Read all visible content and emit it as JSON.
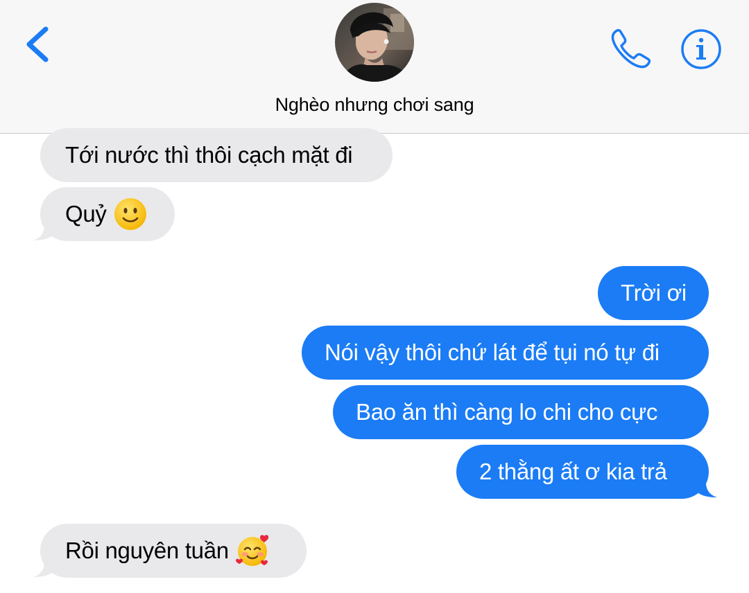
{
  "header": {
    "contact_name": "Nghèo nhưng chơi sang",
    "back_icon": "chevron-left-icon",
    "call_icon": "phone-icon",
    "info_icon": "info-icon"
  },
  "colors": {
    "accent": "#1b7cf5",
    "incoming_bubble": "#e9e9eb",
    "header_bg": "#f7f7f7"
  },
  "messages": [
    {
      "direction": "incoming",
      "text": "Tới nước thì thôi cạch mặt đi"
    },
    {
      "direction": "incoming",
      "text": "Quỷ",
      "emoji": "slightly-smiling-face"
    },
    {
      "direction": "outgoing",
      "text": "Trời ơi"
    },
    {
      "direction": "outgoing",
      "text": "Nói vậy thôi chứ lát để tụi nó tự đi"
    },
    {
      "direction": "outgoing",
      "text": "Bao ăn thì càng lo chi cho cực"
    },
    {
      "direction": "outgoing",
      "text": "2 thằng ất ơ kia trả"
    },
    {
      "direction": "incoming",
      "text": "Rồi nguyên tuần",
      "emoji": "smiling-face-with-hearts"
    }
  ]
}
